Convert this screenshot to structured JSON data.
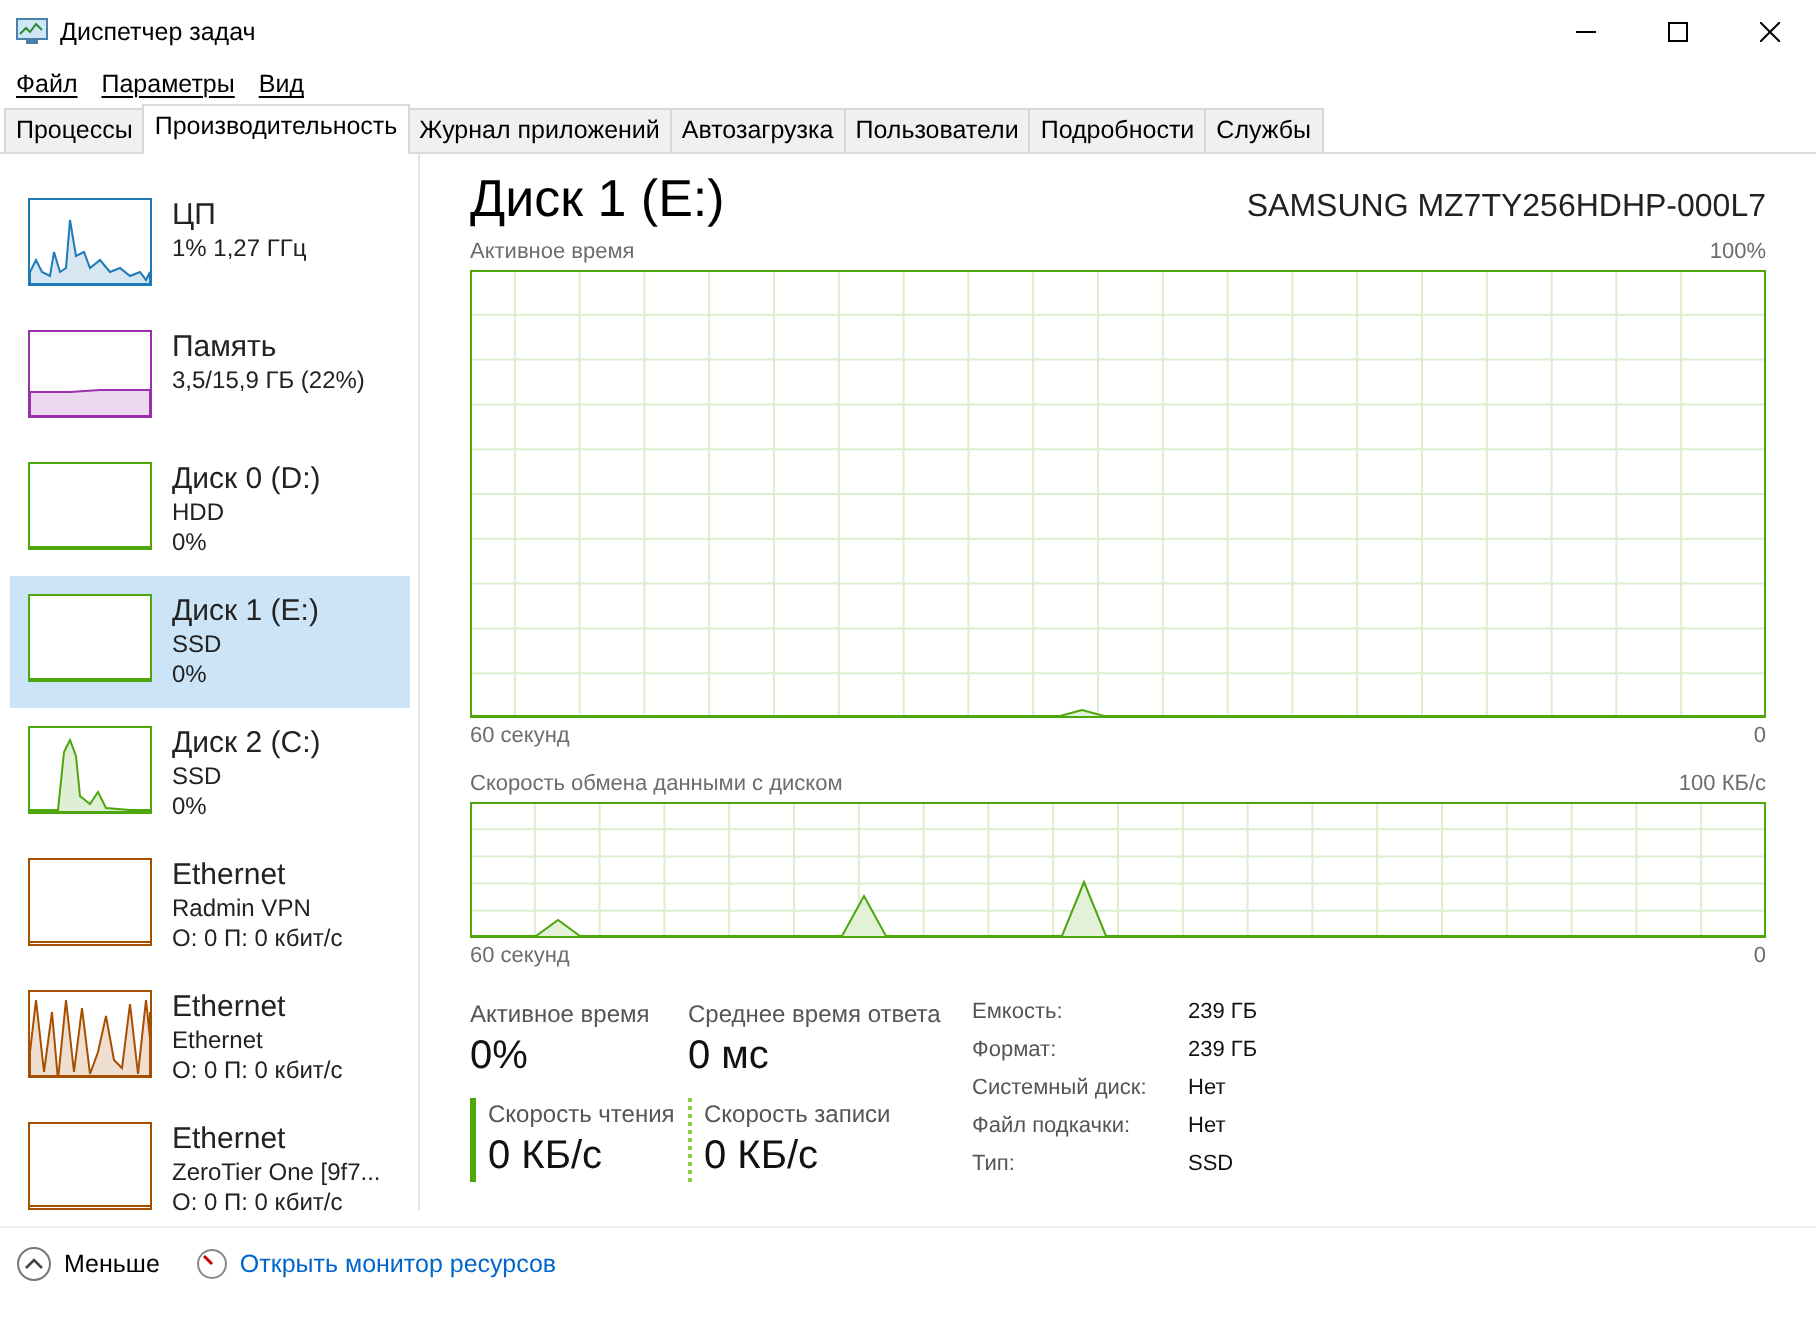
{
  "window": {
    "title": "Диспетчер задач"
  },
  "menu": [
    {
      "label": "Файл"
    },
    {
      "label": "Параметры"
    },
    {
      "label": "Вид"
    }
  ],
  "tabs": [
    {
      "label": "Процессы",
      "selected": false
    },
    {
      "label": "Производительность",
      "selected": true
    },
    {
      "label": "Журнал приложений",
      "selected": false
    },
    {
      "label": "Автозагрузка",
      "selected": false
    },
    {
      "label": "Пользователи",
      "selected": false
    },
    {
      "label": "Подробности",
      "selected": false
    },
    {
      "label": "Службы",
      "selected": false
    }
  ],
  "sidebar": {
    "items": [
      {
        "kind": "cpu",
        "color": "#1e7bb8",
        "title": "ЦП",
        "lines": [
          "1% 1,27 ГГц"
        ],
        "selected": false
      },
      {
        "kind": "memory",
        "color": "#9b2fae",
        "title": "Память",
        "lines": [
          "3,5/15,9 ГБ (22%)"
        ],
        "selected": false
      },
      {
        "kind": "disk-idle",
        "color": "#4da60c",
        "title": "Диск 0 (D:)",
        "lines": [
          "HDD",
          "0%"
        ],
        "selected": false
      },
      {
        "kind": "disk-idle",
        "color": "#4da60c",
        "title": "Диск 1 (E:)",
        "lines": [
          "SSD",
          "0%"
        ],
        "selected": true
      },
      {
        "kind": "disk-spike",
        "color": "#4da60c",
        "title": "Диск 2 (C:)",
        "lines": [
          "SSD",
          "0%"
        ],
        "selected": false
      },
      {
        "kind": "net-idle",
        "color": "#a74f01",
        "title": "Ethernet",
        "lines": [
          "Radmin VPN",
          "О: 0 П: 0 кбит/с"
        ],
        "selected": false
      },
      {
        "kind": "net-busy",
        "color": "#a74f01",
        "title": "Ethernet",
        "lines": [
          "Ethernet",
          "О: 0 П: 0 кбит/с"
        ],
        "selected": false
      },
      {
        "kind": "net-idle",
        "color": "#a74f01",
        "title": "Ethernet",
        "lines": [
          "ZeroTier One [9f7...",
          "О: 0 П: 0 кбит/с"
        ],
        "selected": false
      }
    ]
  },
  "detail": {
    "title": "Диск 1 (E:)",
    "device": "SAMSUNG MZ7TY256HDHP-000L7",
    "graphs": [
      {
        "kind": "active",
        "label": "Активное время",
        "max": "100%",
        "span": "60 секунд",
        "min": "0"
      },
      {
        "kind": "transfer",
        "label": "Скорость обмена данными с диском",
        "max": "100 КБ/с",
        "span": "60 секунд",
        "min": "0"
      }
    ],
    "stats": [
      {
        "kind": "plain",
        "label": "Активное время",
        "value": "0%"
      },
      {
        "kind": "plain",
        "label": "Среднее время ответа",
        "value": "0 мс"
      },
      {
        "kind": "read",
        "label": "Скорость чтения",
        "value": "0 КБ/с"
      },
      {
        "kind": "write",
        "label": "Скорость записи",
        "value": "0 КБ/с"
      }
    ],
    "properties": [
      {
        "label": "Емкость:",
        "value": "239 ГБ"
      },
      {
        "label": "Формат:",
        "value": "239 ГБ"
      },
      {
        "label": "Системный диск:",
        "value": "Нет"
      },
      {
        "label": "Файл подкачки:",
        "value": "Нет"
      },
      {
        "label": "Тип:",
        "value": "SSD"
      }
    ]
  },
  "footer": {
    "less": "Меньше",
    "link": "Открыть монитор ресурсов"
  }
}
